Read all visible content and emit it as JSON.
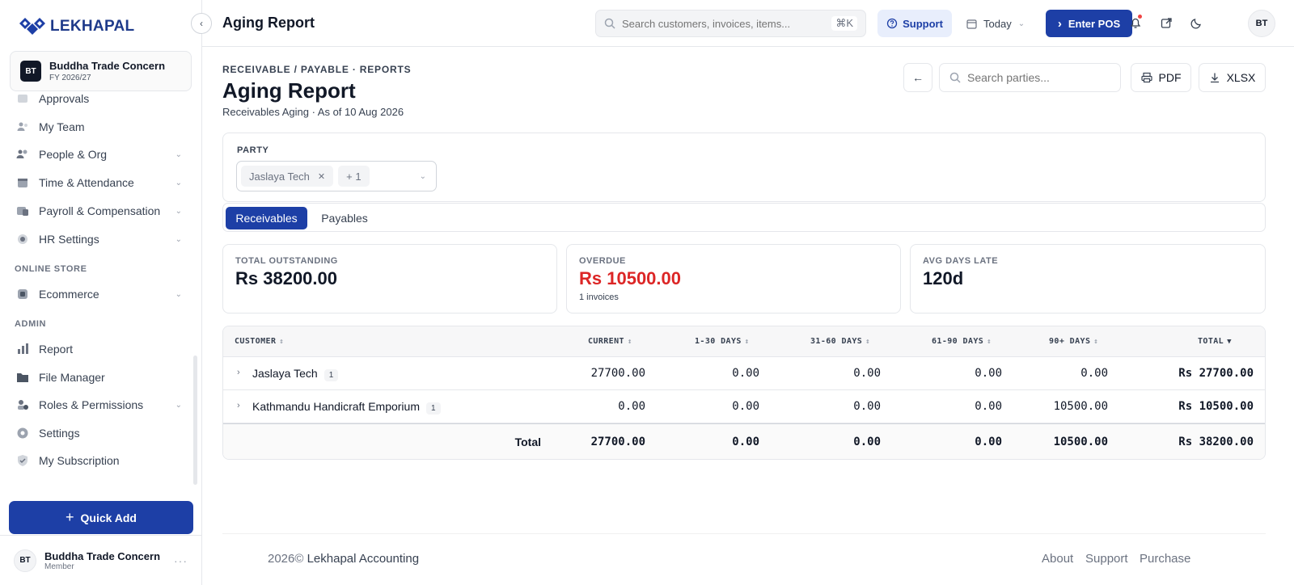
{
  "app": {
    "logo_text": "LEKHAPAL"
  },
  "org": {
    "badge": "BT",
    "name": "Buddha Trade Concern",
    "fy": "FY 2026/27"
  },
  "sidebar": {
    "items": [
      {
        "label": "Approvals",
        "icon": "approval-icon",
        "chevron": false
      },
      {
        "label": "My Team",
        "icon": "team-icon",
        "chevron": false
      },
      {
        "label": "People & Org",
        "icon": "people-icon",
        "chevron": true
      },
      {
        "label": "Time & Attendance",
        "icon": "calendar-icon",
        "chevron": true
      },
      {
        "label": "Payroll & Compensation",
        "icon": "payroll-icon",
        "chevron": true
      },
      {
        "label": "HR Settings",
        "icon": "gear-icon",
        "chevron": true
      }
    ],
    "section_online_store": "ONLINE STORE",
    "online_store_items": [
      {
        "label": "Ecommerce",
        "icon": "store-icon",
        "chevron": true
      }
    ],
    "section_admin": "ADMIN",
    "admin_items": [
      {
        "label": "Report",
        "icon": "bar-chart-icon",
        "chevron": false
      },
      {
        "label": "File Manager",
        "icon": "folder-icon",
        "chevron": false
      },
      {
        "label": "Roles & Permissions",
        "icon": "roles-icon",
        "chevron": true
      },
      {
        "label": "Settings",
        "icon": "settings-icon",
        "chevron": false
      },
      {
        "label": "My Subscription",
        "icon": "shield-icon",
        "chevron": false
      }
    ],
    "quick_add_label": "Quick Add"
  },
  "user": {
    "initials": "BT",
    "name": "Buddha Trade Concern",
    "role": "Member"
  },
  "header": {
    "title": "Aging Report",
    "search_placeholder": "Search customers, invoices, items...",
    "search_shortcut": "⌘K",
    "support_label": "Support",
    "date_label": "Today",
    "pos_label": "Enter POS",
    "avatar_initials": "BT"
  },
  "page": {
    "breadcrumb": "RECEIVABLE / PAYABLE · REPORTS",
    "title": "Aging Report",
    "subtitle": "Receivables Aging · As of 10 Aug 2026",
    "party_search_placeholder": "Search parties...",
    "pdf_label": "PDF",
    "xlsx_label": "XLSX"
  },
  "filter": {
    "label": "PARTY",
    "selected_chip": "Jaslaya Tech",
    "more_chip": "+ 1"
  },
  "tabs": [
    {
      "label": "Receivables",
      "active": true
    },
    {
      "label": "Payables",
      "active": false
    }
  ],
  "stats": {
    "total_outstanding_label": "TOTAL OUTSTANDING",
    "total_outstanding_value": "Rs 38200.00",
    "overdue_label": "OVERDUE",
    "overdue_value": "Rs 10500.00",
    "overdue_sub": "1 invoices",
    "avg_days_label": "AVG DAYS LATE",
    "avg_days_value": "120d"
  },
  "table": {
    "headers": [
      "CUSTOMER",
      "CURRENT",
      "1-30 DAYS",
      "31-60 DAYS",
      "61-90 DAYS",
      "90+ DAYS",
      "TOTAL"
    ],
    "rows": [
      {
        "customer": "Jaslaya Tech",
        "count": "1",
        "current": "27700.00",
        "d1_30": "0.00",
        "d31_60": "0.00",
        "d61_90": "0.00",
        "d90p": "0.00",
        "total": "Rs 27700.00"
      },
      {
        "customer": "Kathmandu Handicraft Emporium",
        "count": "1",
        "current": "0.00",
        "d1_30": "0.00",
        "d31_60": "0.00",
        "d61_90": "0.00",
        "d90p": "10500.00",
        "total": "Rs 10500.00"
      }
    ],
    "totals": {
      "label": "Total",
      "current": "27700.00",
      "d1_30": "0.00",
      "d31_60": "0.00",
      "d61_90": "0.00",
      "d90p": "10500.00",
      "total": "Rs 38200.00"
    }
  },
  "footer": {
    "year": "2026©",
    "brand": "Lekhapal Accounting",
    "links": [
      "About",
      "Support",
      "Purchase"
    ]
  },
  "colors": {
    "primary": "#1d3fa6",
    "danger": "#dc2626"
  }
}
